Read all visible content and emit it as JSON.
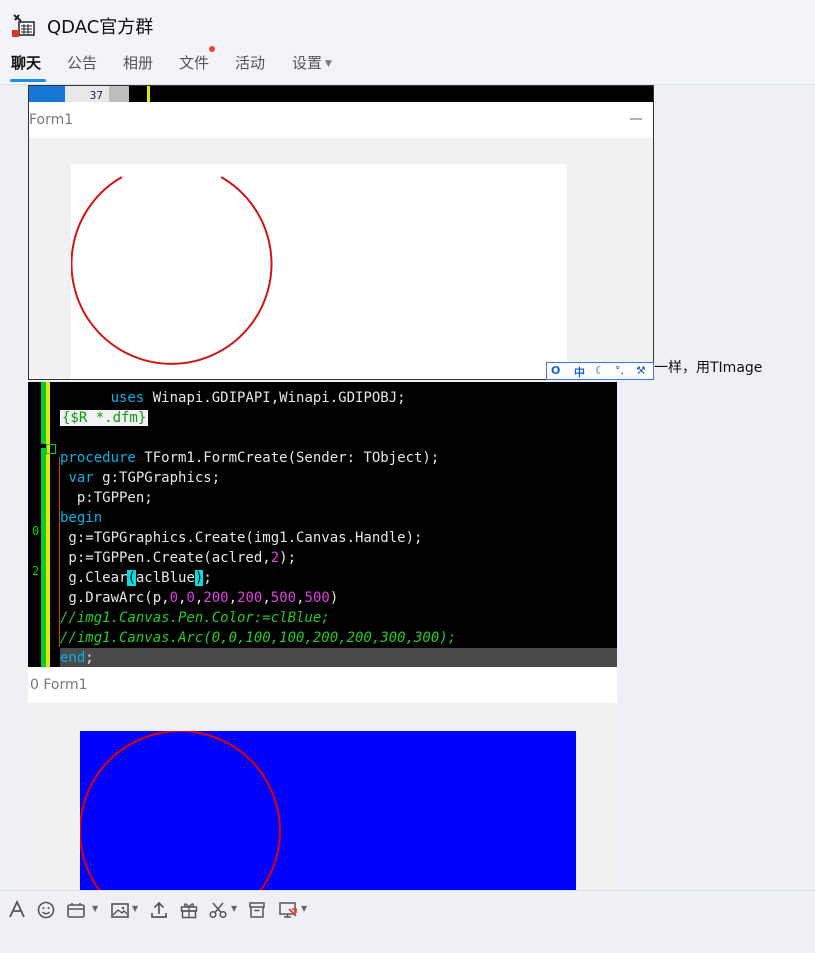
{
  "header": {
    "title": "QDAC官方群",
    "tabs": [
      {
        "label": "聊天",
        "active": true
      },
      {
        "label": "公告"
      },
      {
        "label": "相册"
      },
      {
        "label": "文件",
        "has_notification": true
      },
      {
        "label": "活动"
      },
      {
        "label": "设置",
        "has_dropdown": true
      }
    ]
  },
  "chat": {
    "screenshot1": {
      "line_number": "37",
      "form_title": "Form1",
      "minimize_glyph": "—",
      "ime_items": [
        "中",
        "°,"
      ]
    },
    "message_text": "一样，用TImage",
    "code": {
      "lines": [
        {
          "parts": [
            {
              "t": "      ",
              "c": ""
            },
            {
              "t": "uses",
              "c": "kw"
            },
            {
              "t": " Winapi.GDIPAPI,Winapi.GDIPOBJ;",
              "c": ""
            }
          ]
        },
        {
          "parts": [
            {
              "t": "{$R *.dfm}",
              "c": "dfm"
            }
          ]
        },
        {
          "parts": [
            {
              "t": "",
              "c": ""
            }
          ]
        },
        {
          "parts": [
            {
              "t": "procedure",
              "c": "kw"
            },
            {
              "t": " TForm1.FormCreate(Sender: TObject);",
              "c": ""
            }
          ]
        },
        {
          "parts": [
            {
              "t": " ",
              "c": ""
            },
            {
              "t": "var",
              "c": "kw"
            },
            {
              "t": " g:TGPGraphics;",
              "c": ""
            }
          ]
        },
        {
          "parts": [
            {
              "t": "  p:TGPPen;",
              "c": ""
            }
          ]
        },
        {
          "parts": [
            {
              "t": "begin",
              "c": "kw"
            }
          ]
        },
        {
          "parts": [
            {
              "t": " g:=TGPGraphics.Create(img1.Canvas.Handle);",
              "c": ""
            }
          ]
        },
        {
          "parts": [
            {
              "t": " p:=TGPPen.Create(aclred,",
              "c": ""
            },
            {
              "t": "2",
              "c": "num"
            },
            {
              "t": ");",
              "c": ""
            }
          ]
        },
        {
          "parts": [
            {
              "t": " g.Clear",
              "c": ""
            },
            {
              "t": "(",
              "c": "brk"
            },
            {
              "t": "aclBlue",
              "c": ""
            },
            {
              "t": ")",
              "c": "brk"
            },
            {
              "t": ";",
              "c": ""
            }
          ],
          "highlight": true
        },
        {
          "parts": [
            {
              "t": " g.DrawArc(p,",
              "c": ""
            },
            {
              "t": "0",
              "c": "num"
            },
            {
              "t": ",",
              "c": ""
            },
            {
              "t": "0",
              "c": "num"
            },
            {
              "t": ",",
              "c": ""
            },
            {
              "t": "200",
              "c": "num"
            },
            {
              "t": ",",
              "c": ""
            },
            {
              "t": "200",
              "c": "num"
            },
            {
              "t": ",",
              "c": ""
            },
            {
              "t": "500",
              "c": "num"
            },
            {
              "t": ",",
              "c": ""
            },
            {
              "t": "500",
              "c": "num"
            },
            {
              "t": ")",
              "c": ""
            }
          ]
        },
        {
          "parts": [
            {
              "t": "//img1.Canvas.Pen.Color:=clBlue;",
              "c": "cmt"
            }
          ]
        },
        {
          "parts": [
            {
              "t": "//img1.Canvas.Arc(0,0,100,100,200,200,300,300);",
              "c": "cmt"
            }
          ]
        },
        {
          "parts": [
            {
              "t": "end",
              "c": "kw"
            },
            {
              "t": ";",
              "c": ""
            }
          ]
        }
      ],
      "gutter_marks": [
        "0",
        "2"
      ]
    },
    "form2": {
      "title": "Form1",
      "title_prefix": "0"
    }
  },
  "toolbar": {
    "tools": [
      "font-icon",
      "emoji-icon",
      "screenshot-icon",
      "image-icon",
      "upload-icon",
      "gift-icon",
      "scissors-icon",
      "archive-icon",
      "remote-icon"
    ]
  },
  "colors": {
    "accent": "#1e8ee8",
    "notification": "#f0413c",
    "canvas_blue": "#0000ff",
    "arc_red": "#e00000"
  }
}
